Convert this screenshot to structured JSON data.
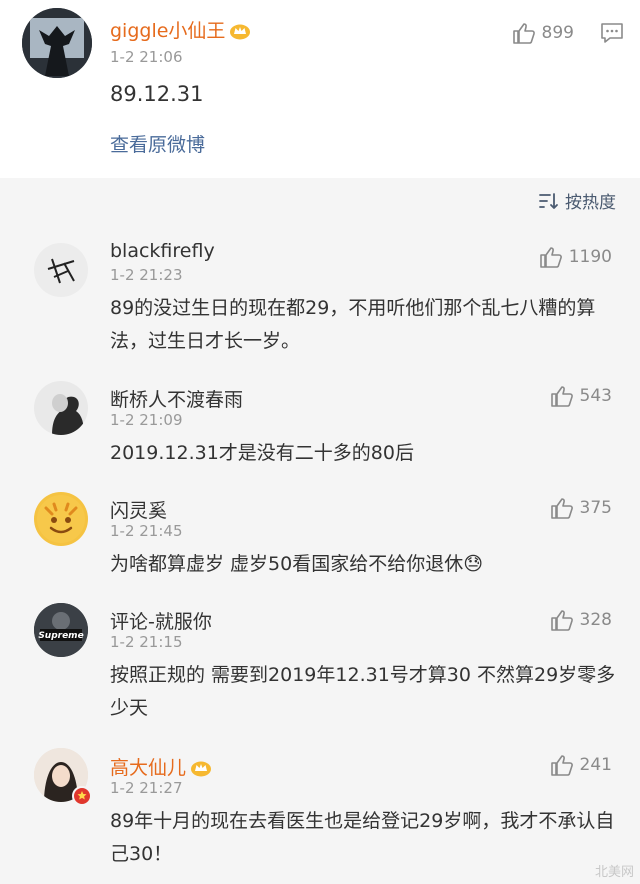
{
  "post": {
    "author": "giggle小仙王",
    "time": "1-2 21:06",
    "likes": "899",
    "text": "89.12.31",
    "view_original": "查看原微博"
  },
  "sort_label": "按热度",
  "comments": [
    {
      "author": "blackfirefly",
      "time": "1-2 21:23",
      "likes": "1190",
      "text": "89的没过生日的现在都29，不用听他们那个乱七八糟的算法，过生日才长一岁。"
    },
    {
      "author": "断桥人不渡春雨",
      "time": "1-2 21:09",
      "likes": "543",
      "text": "2019.12.31才是没有二十多的80后"
    },
    {
      "author": "闪灵奚",
      "time": "1-2 21:45",
      "likes": "375",
      "text": "为啥都算虚岁 虚岁50看国家给不给你退休😓"
    },
    {
      "author": "评论-就服你",
      "time": "1-2 21:15",
      "likes": "328",
      "text": "按照正规的 需要到2019年12.31号才算30 不然算29岁零多少天",
      "avatar_text": "Supreme"
    },
    {
      "author": "高大仙儿",
      "time": "1-2 21:27",
      "likes": "241",
      "text": "89年十月的现在去看医生也是给登记29岁啊，我才不承认自己30！"
    }
  ],
  "watermark": "北美网",
  "colors": {
    "accent_name": "#e66b1d",
    "link": "#4a6b9a",
    "comments_bg": "#f5f5f5"
  }
}
